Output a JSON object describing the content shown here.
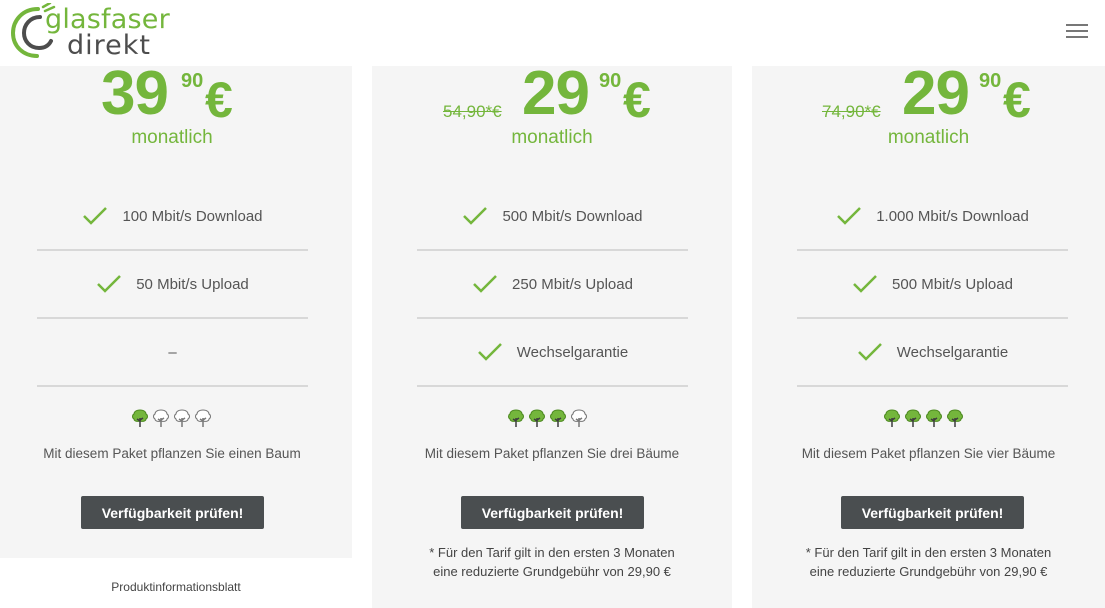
{
  "header": {
    "logo_top": "glasfaser",
    "logo_bottom": "direkt"
  },
  "colors": {
    "brand_green": "#74b63c",
    "button_dark": "#4a4e50",
    "card_bg": "#f5f5f5"
  },
  "plans": [
    {
      "old_price": "",
      "price_main": "39",
      "price_cents": "90",
      "currency": "€",
      "period": "monatlich",
      "features": [
        "100 Mbit/s Download",
        "50 Mbit/s Upload",
        "–"
      ],
      "trees_filled": 1,
      "trees_total": 4,
      "tree_text": "Mit diesem Paket pflanzen Sie einen Baum",
      "cta": "Verfügbarkeit prüfen!",
      "footnote_line1": "",
      "footnote_line2": ""
    },
    {
      "old_price": "54,90*€",
      "price_main": "29",
      "price_cents": "90",
      "currency": "€",
      "period": "monatlich",
      "features": [
        "500 Mbit/s Download",
        "250 Mbit/s Upload",
        "Wechselgarantie"
      ],
      "trees_filled": 3,
      "trees_total": 4,
      "tree_text": "Mit diesem Paket pflanzen Sie drei Bäume",
      "cta": "Verfügbarkeit prüfen!",
      "footnote_line1": "* Für den Tarif gilt in den ersten 3 Monaten",
      "footnote_line2": "eine reduzierte Grundgebühr von 29,90 €"
    },
    {
      "old_price": "74,90*€",
      "price_main": "29",
      "price_cents": "90",
      "currency": "€",
      "period": "monatlich",
      "features": [
        "1.000 Mbit/s Download",
        "500 Mbit/s Upload",
        "Wechselgarantie"
      ],
      "trees_filled": 4,
      "trees_total": 4,
      "tree_text": "Mit diesem Paket pflanzen Sie vier Bäume",
      "cta": "Verfügbarkeit prüfen!",
      "footnote_line1": "* Für den Tarif gilt in den ersten 3 Monaten",
      "footnote_line2": "eine reduzierte Grundgebühr von 29,90 €"
    }
  ],
  "footer": {
    "product_info": "Produktinformationsblatt"
  }
}
